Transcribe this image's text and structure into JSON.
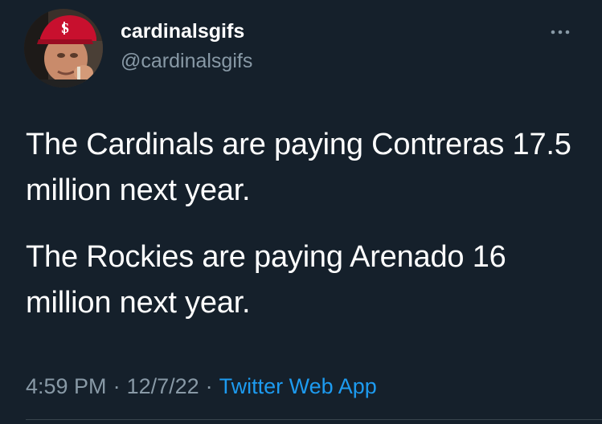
{
  "tweet": {
    "author": {
      "display_name": "cardinalsgifs",
      "handle": "@cardinalsgifs",
      "avatar_icon": "cardinals-fan-avatar-icon"
    },
    "more_icon": "more-options-icon",
    "text": [
      "The Cardinals are paying Contreras 17.5 million next year.",
      "The Rockies are paying Arenado 16 million next year."
    ],
    "time": "4:59 PM",
    "date": "12/7/22",
    "separator": "·",
    "source": "Twitter Web App"
  },
  "colors": {
    "background": "#15202b",
    "text_primary": "#ffffff",
    "text_secondary": "#8899a6",
    "link": "#1d9bf0",
    "divider": "#38444d"
  }
}
